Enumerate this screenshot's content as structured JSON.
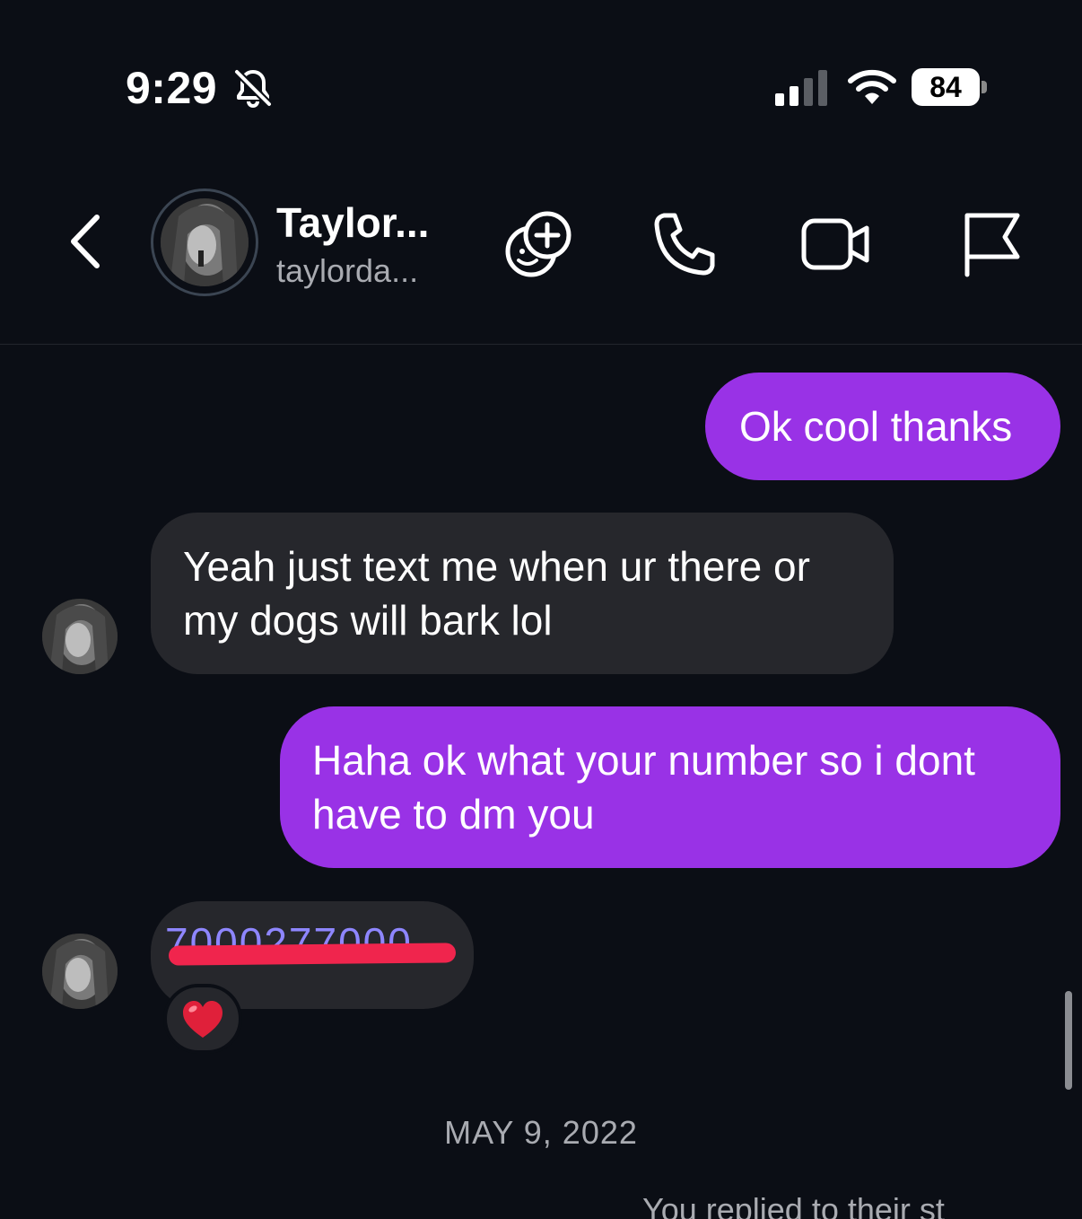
{
  "status_bar": {
    "time": "9:29",
    "battery_level": "84",
    "icons": [
      "bell-slash-icon",
      "signal-icon",
      "wifi-icon",
      "battery-icon"
    ]
  },
  "header": {
    "contact_name": "Taylor...",
    "contact_username": "taylorda...",
    "icons": [
      "back-chevron-icon",
      "face-add-icon",
      "phone-icon",
      "video-icon",
      "flag-icon"
    ]
  },
  "messages": [
    {
      "direction": "outgoing",
      "text": "Ok cool thanks"
    },
    {
      "direction": "incoming",
      "text_line1": "Yeah just text me when ur there or",
      "text_line2": "my dogs will bark lol"
    },
    {
      "direction": "outgoing",
      "text_line1": "Haha ok what your number so i dont",
      "text_line2": "have to dm you"
    },
    {
      "direction": "incoming",
      "text": "7000277000",
      "redacted": true,
      "reaction": "❤️"
    }
  ],
  "date_divider": "MAY 9, 2022",
  "footer_cutoff_text": "You replied to their st",
  "colors": {
    "background": "#0b0e15",
    "outgoing_bubble": "#9932e6",
    "incoming_bubble": "#26272c",
    "redaction": "#f0254d"
  }
}
